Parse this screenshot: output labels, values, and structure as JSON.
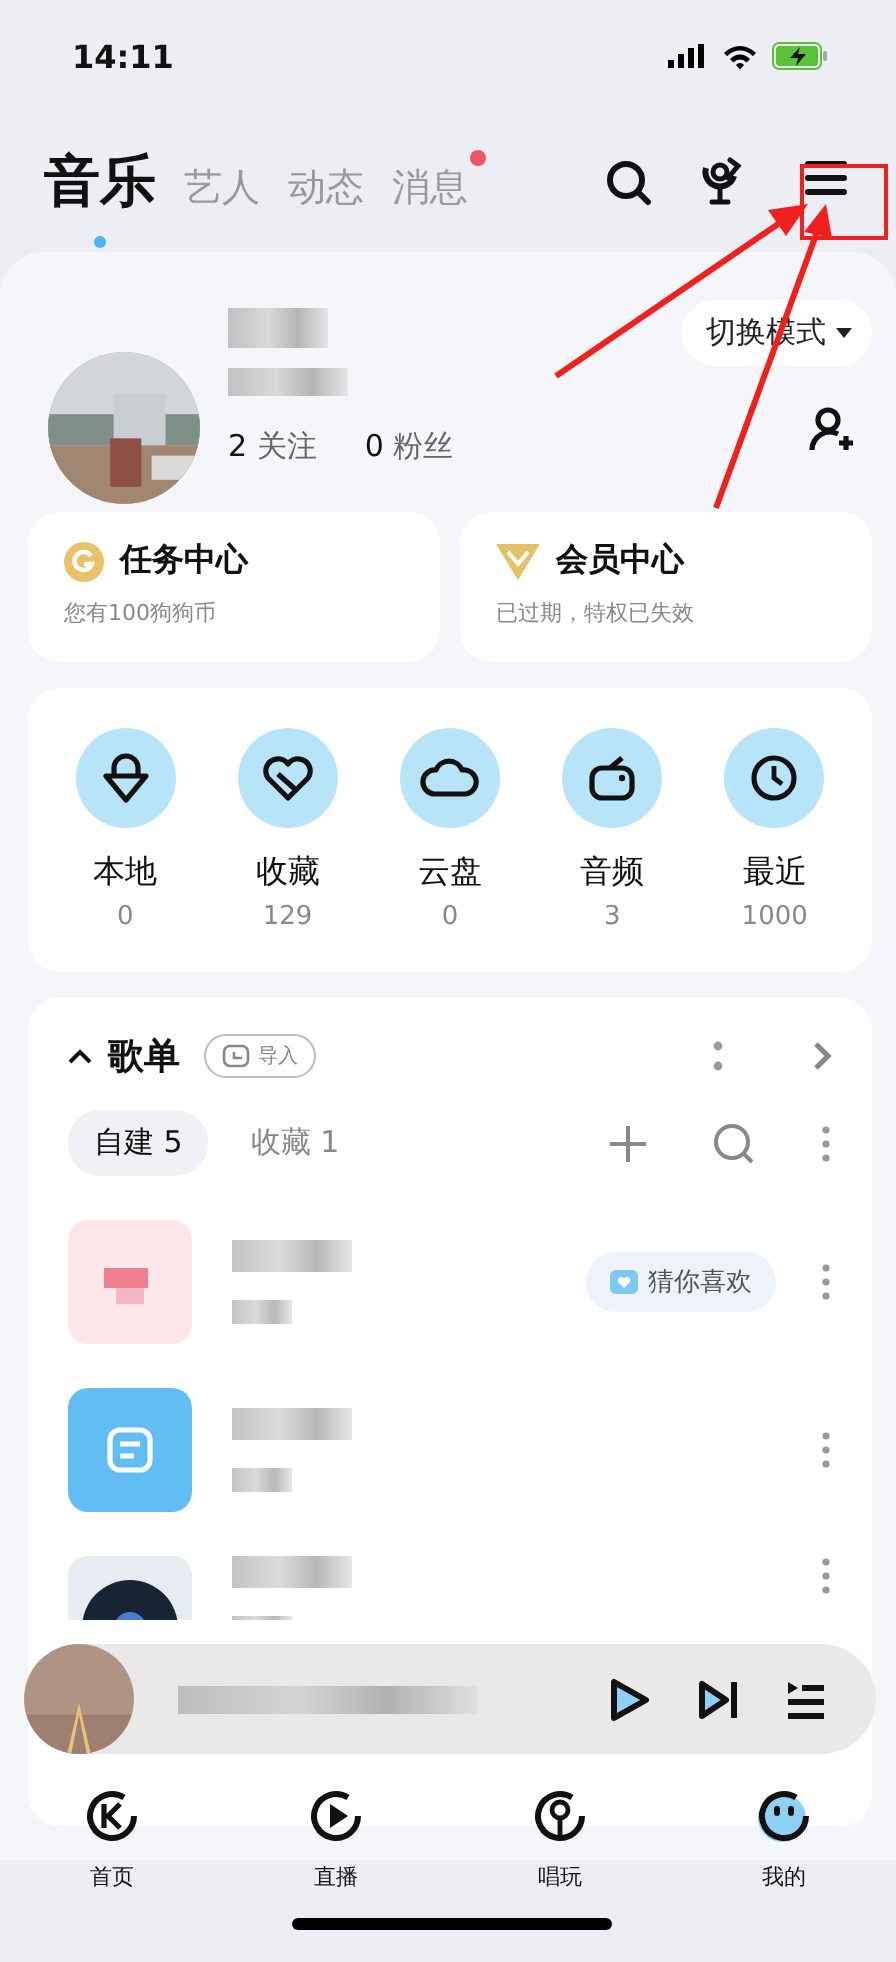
{
  "status_bar": {
    "time": "14:11"
  },
  "tabs": [
    {
      "label": "音乐",
      "selected": true,
      "badge": false
    },
    {
      "label": "艺人",
      "selected": false,
      "badge": false
    },
    {
      "label": "动态",
      "selected": false,
      "badge": false
    },
    {
      "label": "消息",
      "selected": false,
      "badge": true
    }
  ],
  "profile": {
    "following_count": "2",
    "following_label": "关注",
    "followers_count": "0",
    "followers_label": "粉丝",
    "mode_button": "切换模式"
  },
  "cards": [
    {
      "kind": "coin",
      "title": "任务中心",
      "subtitle": "您有100狗狗币"
    },
    {
      "kind": "diamond",
      "title": "会员中心",
      "subtitle": "已过期，特权已失效"
    }
  ],
  "shortcuts": [
    {
      "kind": "local",
      "label": "本地",
      "count": "0"
    },
    {
      "kind": "favorite",
      "label": "收藏",
      "count": "129"
    },
    {
      "kind": "cloud",
      "label": "云盘",
      "count": "0"
    },
    {
      "kind": "radio",
      "label": "音频",
      "count": "3"
    },
    {
      "kind": "recent",
      "label": "最近",
      "count": "1000"
    }
  ],
  "playlists": {
    "title": "歌单",
    "import_label": "导入",
    "tabs": [
      {
        "label": "自建 5",
        "selected": true
      },
      {
        "label": "收藏 1",
        "selected": false
      }
    ],
    "rows": [
      {
        "kind": "liked",
        "tag": "猜你喜欢"
      },
      {
        "kind": "default"
      },
      {
        "kind": "vinyl"
      }
    ]
  },
  "bottom_nav": [
    {
      "kind": "home",
      "label": "首页",
      "selected": false
    },
    {
      "kind": "live",
      "label": "直播",
      "selected": false
    },
    {
      "kind": "sing",
      "label": "唱玩",
      "selected": false
    },
    {
      "kind": "me",
      "label": "我的",
      "selected": true
    }
  ]
}
